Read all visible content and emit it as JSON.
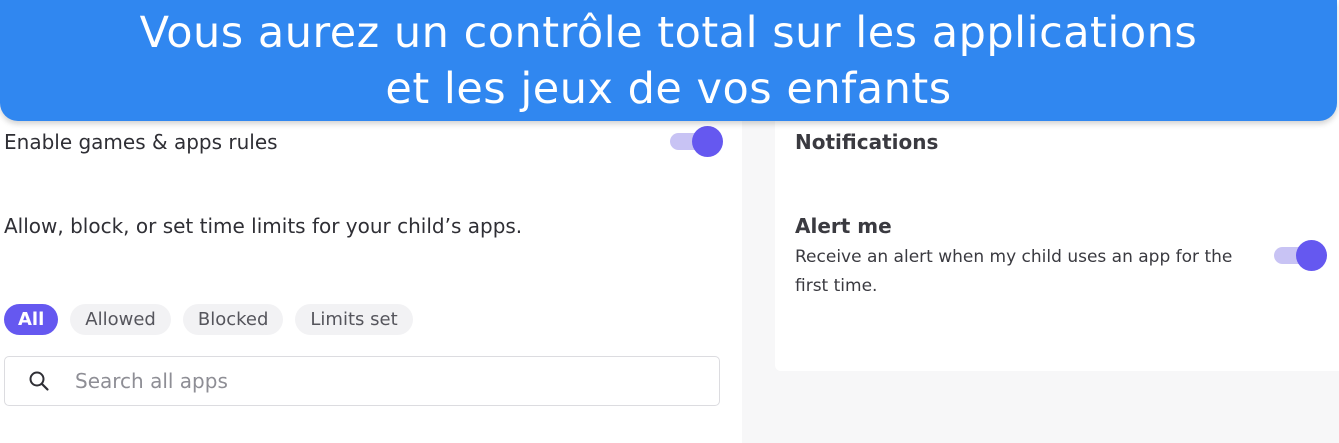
{
  "banner": {
    "line1": "Vous aurez un contrôle total sur les applications",
    "line2": "et les jeux de vos enfants"
  },
  "games_apps": {
    "enable_label": "Enable games & apps rules",
    "enabled": true,
    "description": "Allow, block, or set time limits for your child’s apps.",
    "filters": [
      "All",
      "Allowed",
      "Blocked",
      "Limits set"
    ],
    "active_filter": "All",
    "search": {
      "placeholder": "Search all apps",
      "icon": "search-icon"
    }
  },
  "notifications": {
    "title": "Notifications",
    "alert_title": "Alert me",
    "alert_description": "Receive an alert when my child uses an app for the first time.",
    "alert_enabled": true
  },
  "colors": {
    "banner": "#3087f0",
    "accent": "#6558f0",
    "toggle_track": "#c8c3f4"
  }
}
